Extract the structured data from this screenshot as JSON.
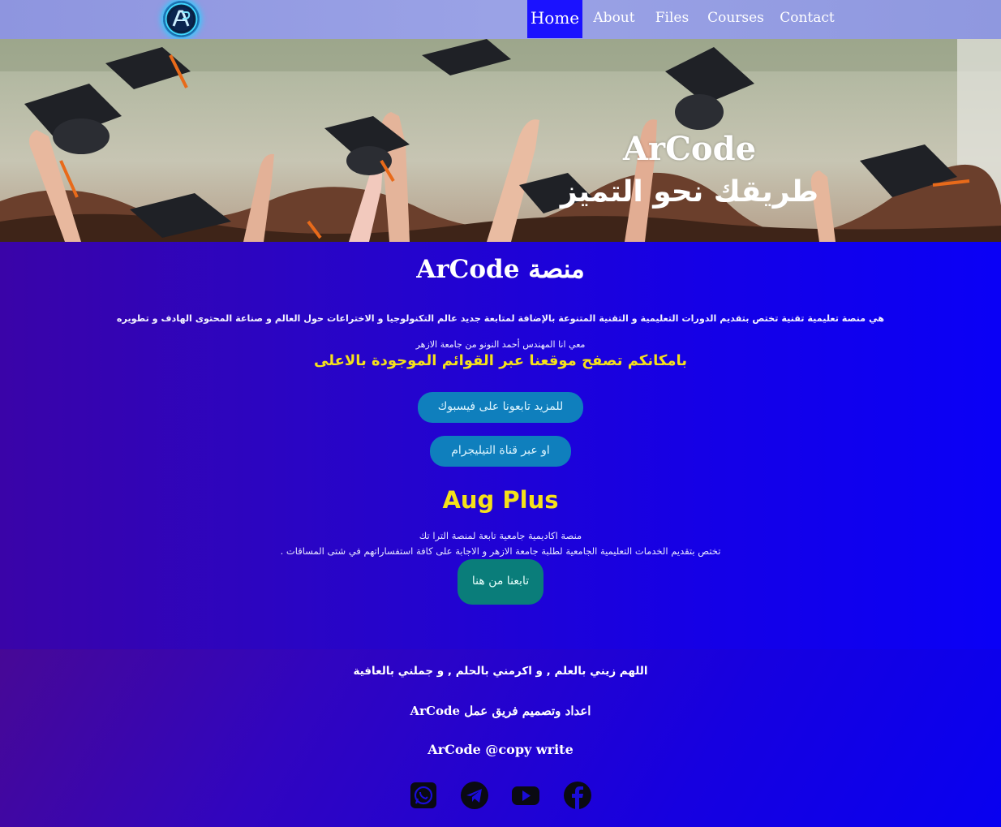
{
  "nav": {
    "logo_text": "AR",
    "items": [
      {
        "label": "Home"
      },
      {
        "label": "About"
      },
      {
        "label": "Files"
      },
      {
        "label": "Courses"
      },
      {
        "label": "Contact"
      }
    ]
  },
  "hero": {
    "title": "ArCode",
    "subtitle": "طريقك نحو التميز"
  },
  "about": {
    "title": "منصة ArCode",
    "description": "هي منصة تعليمية تقنية تختص بتقديم الدورات التعليمية و التقنية المتنوعة بالإضافة لمتابعة جديد عالم التكنولوجيا و الاختراعات حول العالم و صناعة المحتوى الهادف و تطويره",
    "engineer": "معي انا المهندس أحمد النونو من جامعة الازهر",
    "browse_note": "بامكانكم تصفح موقعنا عبر القوائم الموجودة بالاعلى",
    "facebook_button": "للمزيد تابعونا على فيسبوك",
    "telegram_button": "او عبر قناة التيليجرام"
  },
  "aug": {
    "title": "Aug Plus",
    "desc_line1": "منصة اكاديمية جامعية تابعة لمنصة الترا تك",
    "desc_line2": "تختص بتقديم الخدمات التعليمية الجامعية لطلبة جامعة الازهر و الاجابة على كافة استفساراتهم في شتى المساقات .",
    "follow_button": "تابعنا من هنا"
  },
  "footer": {
    "dua": "اللهم زيني بالعلم , و اكرمني بالحلم , و جملني بالعافية",
    "team": "اعداد وتصميم فريق عمل ArCode",
    "copy": "ArCode @copy write",
    "social_icons": [
      "whatsapp-icon",
      "telegram-icon",
      "youtube-icon",
      "facebook-icon"
    ]
  },
  "colors": {
    "nav_bg": "#949ce3",
    "nav_active": "#1b12ff",
    "main_bg": "#1a0cd8",
    "accent_yellow": "#f5e11a",
    "button_blue": "#0f7fbd",
    "button_teal": "#0a7d7a"
  }
}
